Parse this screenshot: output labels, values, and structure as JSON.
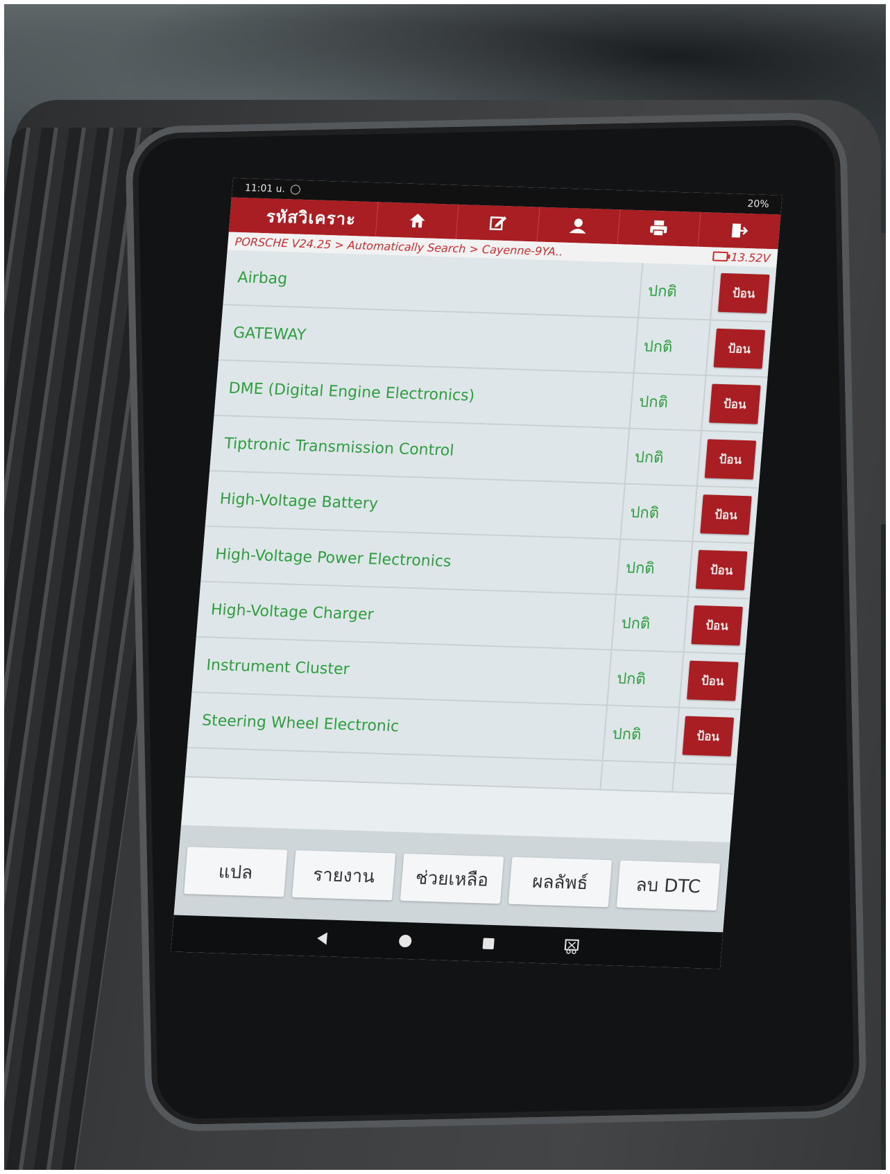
{
  "status_bar": {
    "time": "11:01 u.",
    "battery": "20%"
  },
  "toolbar": {
    "title": "รหัสวิเคราะ",
    "icons": [
      "home-icon",
      "edit-icon",
      "user-icon",
      "print-icon",
      "exit-icon"
    ]
  },
  "breadcrumb": {
    "path": "PORSCHE V24.25 > Automatically Search > Cayenne-9YA..",
    "voltage": "13.52V"
  },
  "systems": [
    {
      "name": "Airbag",
      "status": "ปกติ",
      "action": "ป้อน"
    },
    {
      "name": "GATEWAY",
      "status": "ปกติ",
      "action": "ป้อน"
    },
    {
      "name": "DME (Digital Engine Electronics)",
      "status": "ปกติ",
      "action": "ป้อน"
    },
    {
      "name": "Tiptronic Transmission Control",
      "status": "ปกติ",
      "action": "ป้อน"
    },
    {
      "name": "High-Voltage Battery",
      "status": "ปกติ",
      "action": "ป้อน"
    },
    {
      "name": "High-Voltage Power Electronics",
      "status": "ปกติ",
      "action": "ป้อน"
    },
    {
      "name": "High-Voltage Charger",
      "status": "ปกติ",
      "action": "ป้อน"
    },
    {
      "name": "Instrument Cluster",
      "status": "ปกติ",
      "action": "ป้อน"
    },
    {
      "name": "Steering Wheel Electronic",
      "status": "ปกติ",
      "action": "ป้อน"
    }
  ],
  "bottom_buttons": [
    "แปล",
    "รายงาน",
    "ช่วยเหลือ",
    "ผลลัพธ์",
    "ลบ DTC"
  ],
  "nav": [
    "back-icon",
    "home-circle-icon",
    "recents-square-icon",
    "screenshot-icon"
  ],
  "colors": {
    "accent": "#a81e22",
    "ok_text": "#2e9e3e",
    "list_bg": "#dfe6ea"
  }
}
